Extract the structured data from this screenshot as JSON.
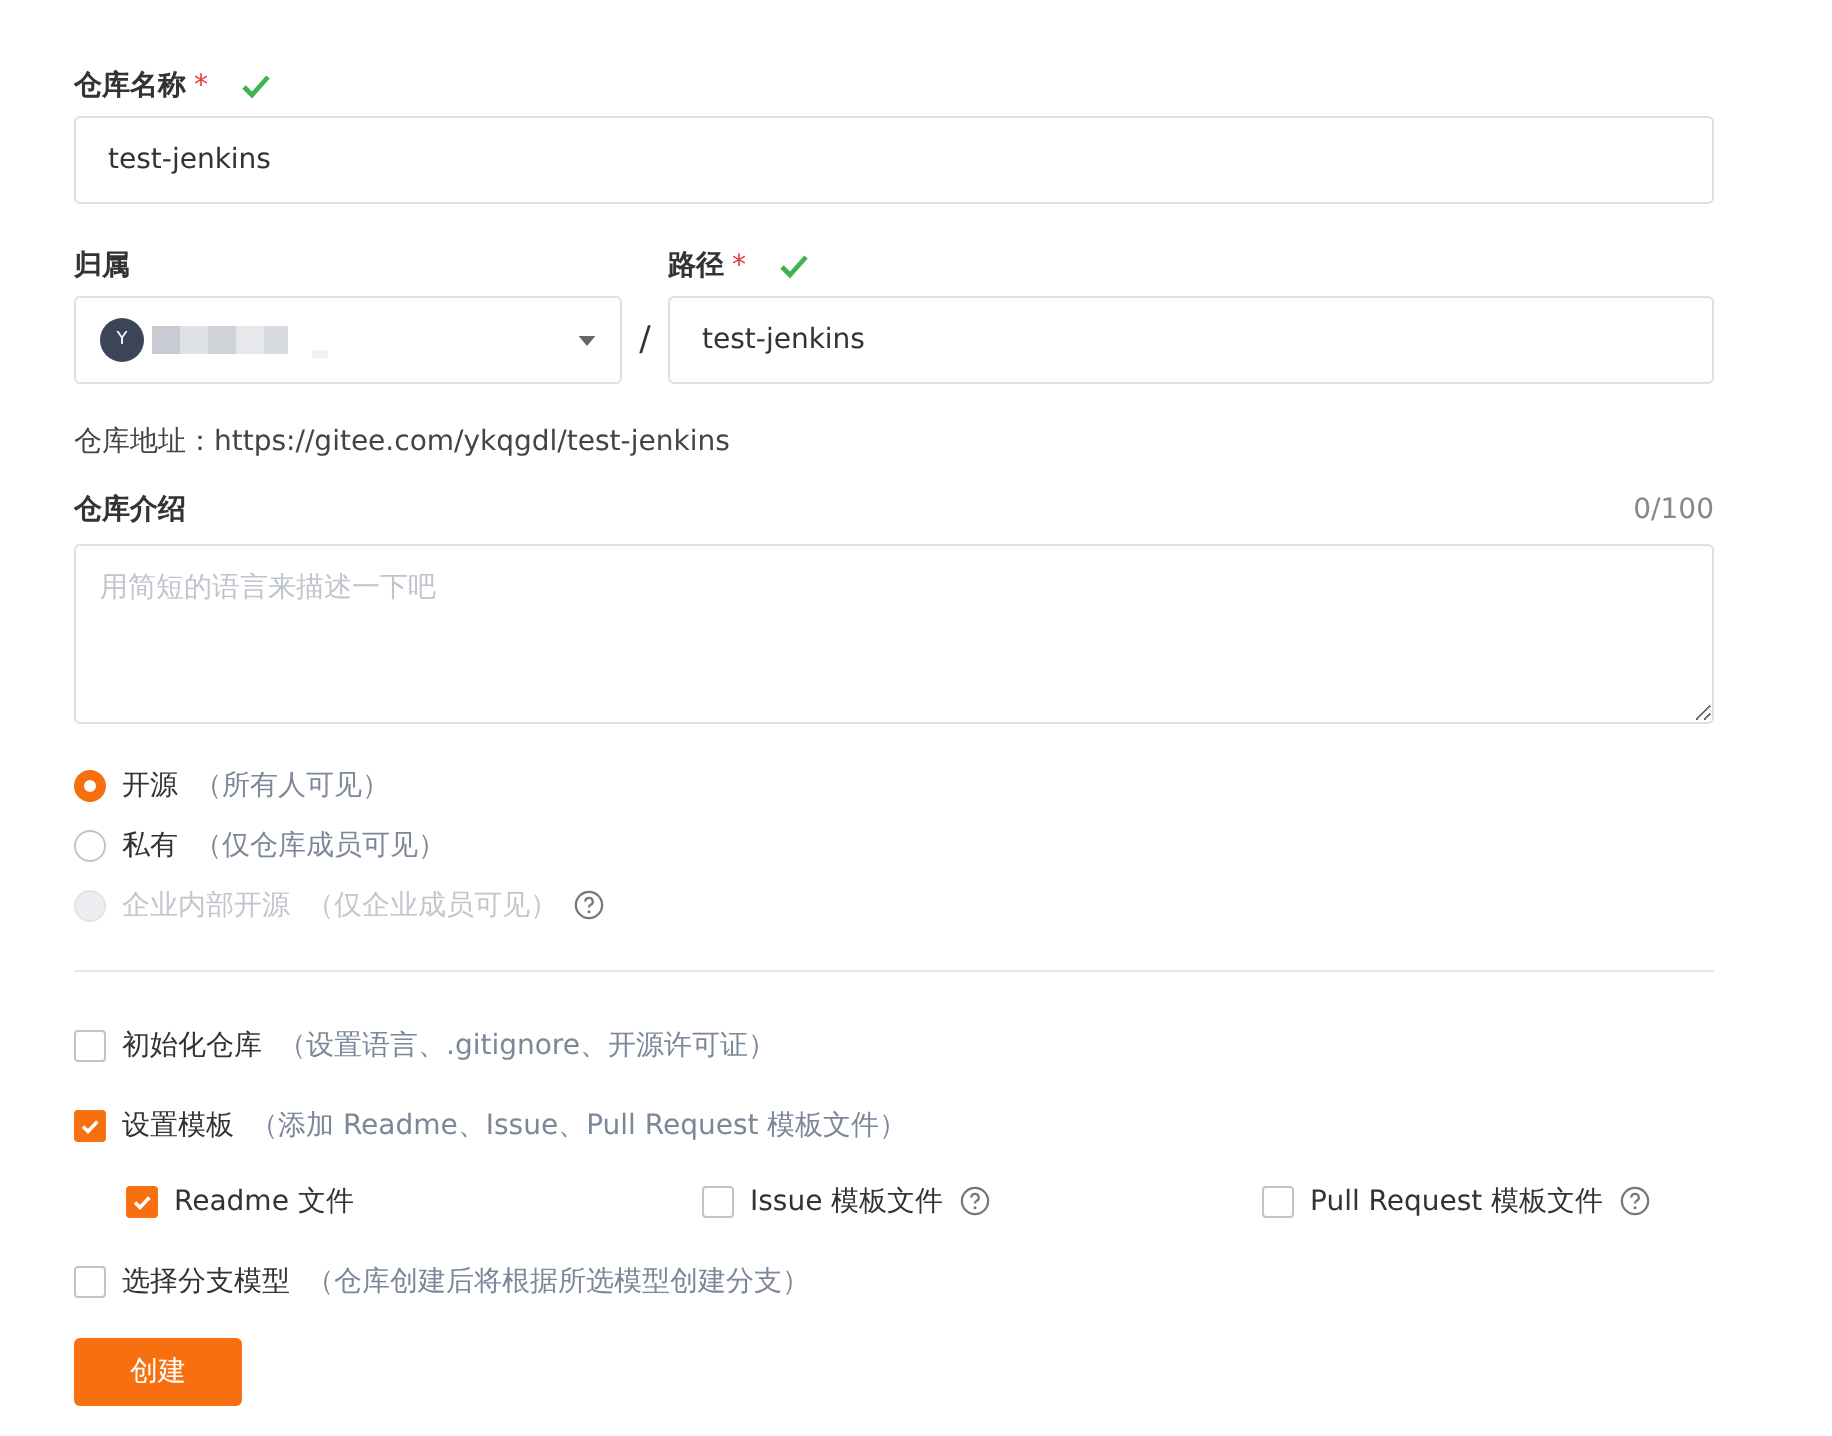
{
  "repo_name": {
    "label": "仓库名称",
    "required": "*",
    "valid": true,
    "value": "test-jenkins"
  },
  "owner": {
    "label": "归属",
    "avatar_letter": "Y"
  },
  "separator": "/",
  "path": {
    "label": "路径",
    "required": "*",
    "valid": true,
    "value": "test-jenkins"
  },
  "address": {
    "label": "仓库地址：",
    "url": "https://gitee.com/ykqgdl/test-jenkins"
  },
  "description": {
    "label": "仓库介绍",
    "counter": "0/100",
    "placeholder": "用简短的语言来描述一下吧"
  },
  "visibility": [
    {
      "label": "开源",
      "hint": "（所有人可见）",
      "selected": true,
      "disabled": false,
      "help": false
    },
    {
      "label": "私有",
      "hint": "（仅仓库成员可见）",
      "selected": false,
      "disabled": false,
      "help": false
    },
    {
      "label": "企业内部开源",
      "hint": "（仅企业成员可见）",
      "selected": false,
      "disabled": true,
      "help": true
    }
  ],
  "options": [
    {
      "label": "初始化仓库",
      "hint": "（设置语言、.gitignore、开源许可证）",
      "checked": false
    },
    {
      "label": "设置模板",
      "hint": "（添加 Readme、Issue、Pull Request 模板文件）",
      "checked": true,
      "children": [
        {
          "label": "Readme 文件",
          "checked": true,
          "help": false
        },
        {
          "label": "Issue 模板文件",
          "checked": false,
          "help": true
        },
        {
          "label": "Pull Request 模板文件",
          "checked": false,
          "help": true
        }
      ]
    },
    {
      "label": "选择分支模型",
      "hint": "（仓库创建后将根据所选模型创建分支）",
      "checked": false
    }
  ],
  "submit": "创建"
}
